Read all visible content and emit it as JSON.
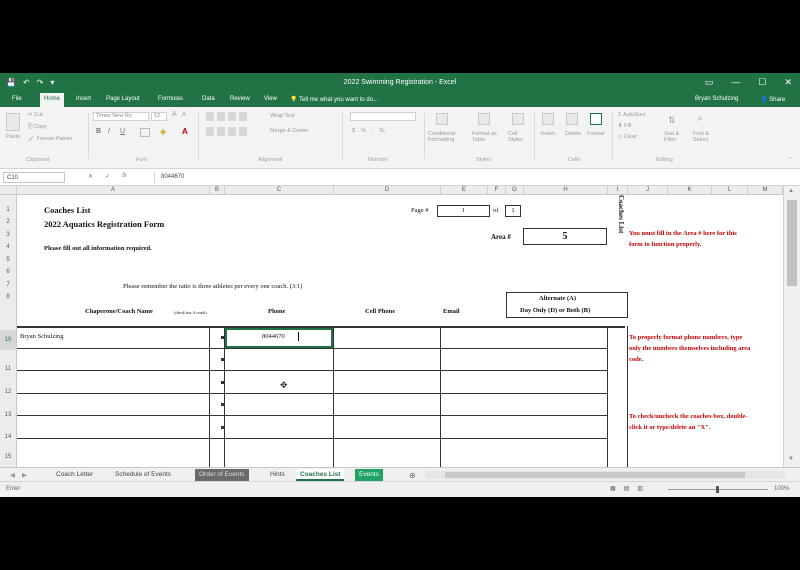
{
  "window": {
    "title": "2022 Swimming Registration - Excel",
    "qat": [
      "💾",
      "↶",
      "↷",
      "▾"
    ],
    "controls": [
      "▭",
      "—",
      "☐",
      "✕"
    ]
  },
  "ribbon": {
    "tabs": [
      "File",
      "Home",
      "Insert",
      "Page Layout",
      "Formulas",
      "Data",
      "Review",
      "View"
    ],
    "tell_me": "Tell me what you want to do...",
    "user": "Bryan Schulzing",
    "share": "Share",
    "clipboard": {
      "paste": "Paste",
      "cut": "Cut",
      "copy": "Copy",
      "format_painter": "Format Painter",
      "group": "Clipboard"
    },
    "font": {
      "name": "Times New Ro",
      "size": "12",
      "group": "Font"
    },
    "alignment": {
      "wrap": "Wrap Text",
      "merge": "Merge & Center",
      "group": "Alignment"
    },
    "number": {
      "group": "Number"
    },
    "styles": {
      "conditional": "Conditional Formatting",
      "format_table": "Format as Table",
      "cell_styles": "Cell Styles",
      "group": "Styles"
    },
    "cells": {
      "insert": "Insert",
      "delete": "Delete",
      "format": "Format",
      "group": "Cells"
    },
    "editing": {
      "autosum": "AutoSum",
      "fill": "Fill",
      "clear": "Clear",
      "sort": "Sort & Filter",
      "find": "Find & Select",
      "group": "Editing"
    }
  },
  "formula_bar": {
    "name_box": "C10",
    "cancel": "✕",
    "enter": "✓",
    "fx": "fx",
    "value": "8044670"
  },
  "columns": [
    "A",
    "B",
    "C",
    "D",
    "E",
    "F",
    "G",
    "H",
    "I",
    "J",
    "K",
    "L",
    "M"
  ],
  "rows": [
    "1",
    "2",
    "3",
    "4",
    "5",
    "6",
    "7",
    "8",
    "9",
    "10",
    "11",
    "12",
    "13",
    "14",
    "15"
  ],
  "sheet": {
    "title": "Coaches List",
    "subtitle": "2022 Aquatics Registration Form",
    "instruction": "Please fill out all information required.",
    "page_label": "Page #",
    "page_value": "1",
    "of_label": "of",
    "of_value": "1",
    "area_label": "Area #",
    "area_value": "5",
    "ratio_note": "Please remember the ratio is three athletes per every one coach. (3:1)",
    "vertical_label": "Coaches List",
    "headers": {
      "name": "Chaperone/Coach Name",
      "name_hint": "(check box if coach)",
      "phone": "Phone",
      "cell": "Cell Phone",
      "email": "Email",
      "alternate": "Alternate (A)",
      "day_only": "Day Only (D) or Both (B)"
    },
    "entry_name": "Bryan Schulzing",
    "entry_phone": "8044670",
    "notes": {
      "area": "You must fill in the Area # here for this form to function properly.",
      "phone": "To properly format phone numbers, type only the numbers themselves including area code.",
      "checkbox": "To check/uncheck the coaches box, double-click it or type/delete an \"X\"."
    }
  },
  "sheet_tabs": [
    "Coach Letter",
    "Schedule of Events",
    "Order of Events",
    "Hints",
    "Coaches List",
    "Events"
  ],
  "status": {
    "mode": "Enter",
    "zoom": "100%"
  },
  "colors": {
    "excel_green": "#217346",
    "note_red": "#c00000"
  }
}
